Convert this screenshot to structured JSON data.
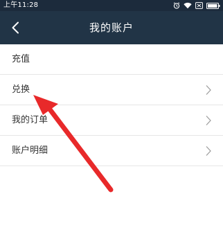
{
  "status_bar": {
    "time": "上午11:28",
    "icons": [
      "alarm-icon",
      "wifi-icon",
      "sim-blocked-icon",
      "battery-icon"
    ]
  },
  "header": {
    "title": "我的账户",
    "back_icon": "chevron-left-icon"
  },
  "menu": {
    "items": [
      {
        "label": "充值",
        "has_chevron": false
      },
      {
        "label": "兑换",
        "has_chevron": true
      },
      {
        "label": "我的订单",
        "has_chevron": true
      },
      {
        "label": "账户明细",
        "has_chevron": true
      }
    ]
  },
  "annotation": {
    "arrow_color": "#e8292a",
    "icon": "red-arrow-icon"
  },
  "colors": {
    "status_bar_bg": "#1c2b3c",
    "header_bg": "#213446",
    "divider": "#e6e6e6",
    "text": "#333333",
    "chevron": "#9a9a9a"
  }
}
